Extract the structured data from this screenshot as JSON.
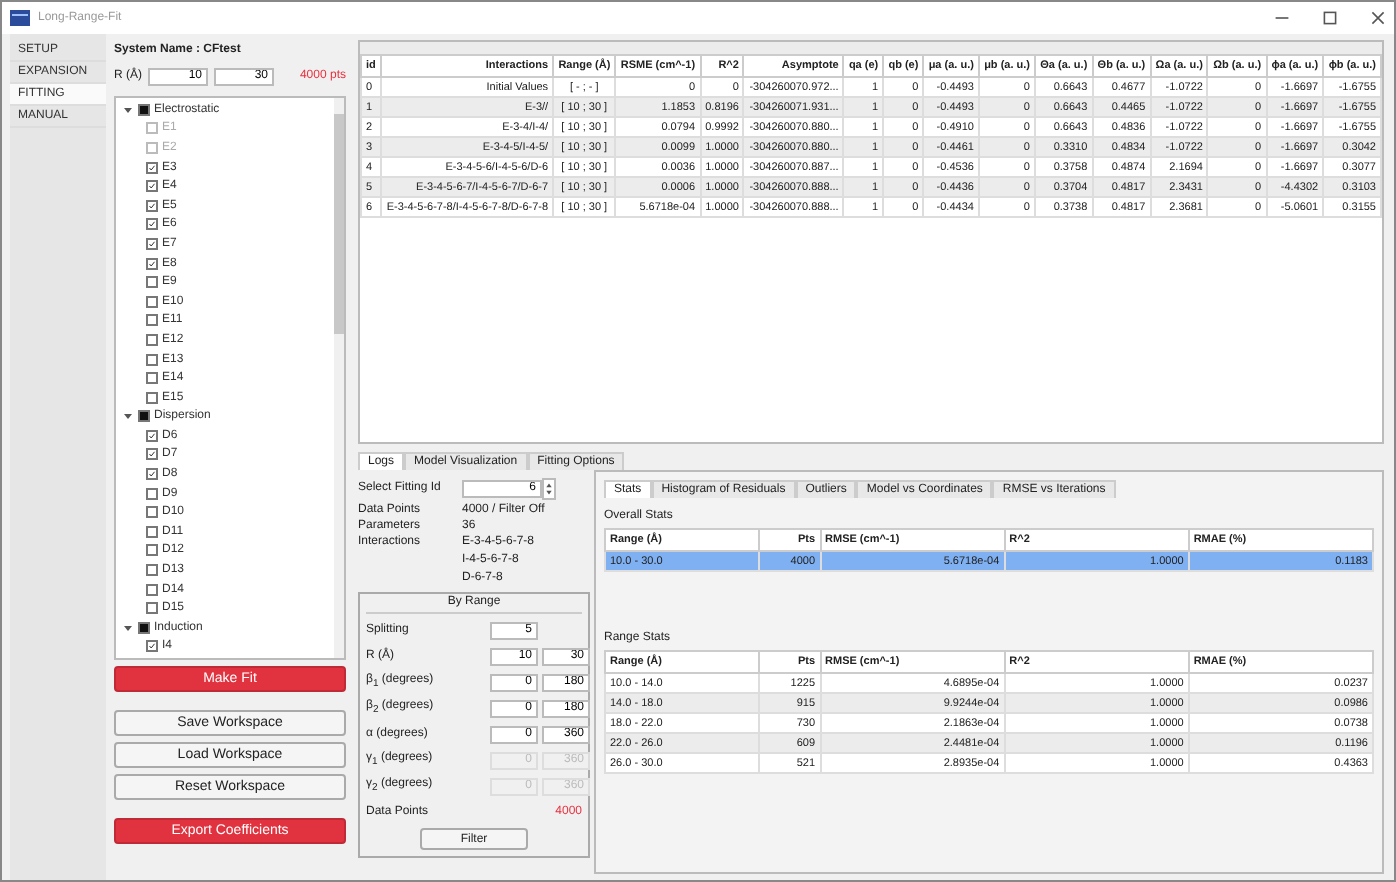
{
  "window": {
    "title": "Long-Range-Fit"
  },
  "nav": [
    {
      "label": "SETUP",
      "selected": false
    },
    {
      "label": "EXPANSION",
      "selected": false
    },
    {
      "label": "FITTING",
      "selected": true
    },
    {
      "label": "MANUAL",
      "selected": false
    }
  ],
  "system_name": "System Name : CFtest",
  "range": {
    "label": "R (Å)",
    "min": "10",
    "max": "30",
    "points": "4000 pts"
  },
  "tree": [
    {
      "label": "Electrostatic",
      "expanded": true,
      "partial": true,
      "children": [
        {
          "label": "E1",
          "checked": false,
          "disabled": true
        },
        {
          "label": "E2",
          "checked": false,
          "disabled": true
        },
        {
          "label": "E3",
          "checked": true,
          "disabled": false
        },
        {
          "label": "E4",
          "checked": true,
          "disabled": false
        },
        {
          "label": "E5",
          "checked": true,
          "disabled": false
        },
        {
          "label": "E6",
          "checked": true,
          "disabled": false
        },
        {
          "label": "E7",
          "checked": true,
          "disabled": false
        },
        {
          "label": "E8",
          "checked": true,
          "disabled": false
        },
        {
          "label": "E9",
          "checked": false,
          "disabled": false
        },
        {
          "label": "E10",
          "checked": false,
          "disabled": false
        },
        {
          "label": "E11",
          "checked": false,
          "disabled": false
        },
        {
          "label": "E12",
          "checked": false,
          "disabled": false
        },
        {
          "label": "E13",
          "checked": false,
          "disabled": false
        },
        {
          "label": "E14",
          "checked": false,
          "disabled": false
        },
        {
          "label": "E15",
          "checked": false,
          "disabled": false
        }
      ]
    },
    {
      "label": "Dispersion",
      "expanded": true,
      "partial": true,
      "children": [
        {
          "label": "D6",
          "checked": true,
          "disabled": false
        },
        {
          "label": "D7",
          "checked": true,
          "disabled": false
        },
        {
          "label": "D8",
          "checked": true,
          "disabled": false
        },
        {
          "label": "D9",
          "checked": false,
          "disabled": false
        },
        {
          "label": "D10",
          "checked": false,
          "disabled": false
        },
        {
          "label": "D11",
          "checked": false,
          "disabled": false
        },
        {
          "label": "D12",
          "checked": false,
          "disabled": false
        },
        {
          "label": "D13",
          "checked": false,
          "disabled": false
        },
        {
          "label": "D14",
          "checked": false,
          "disabled": false
        },
        {
          "label": "D15",
          "checked": false,
          "disabled": false
        }
      ]
    },
    {
      "label": "Induction",
      "expanded": true,
      "partial": true,
      "children": [
        {
          "label": "I4",
          "checked": true,
          "disabled": false
        }
      ]
    }
  ],
  "buttons": [
    {
      "label": "Make Fit",
      "kind": "primary"
    },
    {
      "label": "Save Workspace",
      "kind": "normal"
    },
    {
      "label": "Load Workspace",
      "kind": "normal"
    },
    {
      "label": "Reset Workspace",
      "kind": "normal"
    },
    {
      "label": "Export Coefficients",
      "kind": "primary"
    }
  ],
  "results": {
    "columns": [
      "id",
      "Interactions",
      "Range (Å)",
      "RSME (cm^-1)",
      "R^2",
      "Asymptote",
      "qa (e)",
      "qb (e)",
      "μa (a. u.)",
      "μb (a. u.)",
      "Θa (a. u.)",
      "Θb (a. u.)",
      "Ωa (a. u.)",
      "Ωb (a. u.)",
      "ϕa (a. u.)",
      "ϕb (a. u.)"
    ],
    "rows": [
      [
        "0",
        "Initial Values",
        "[ - ; - ]",
        "0",
        "0",
        "-304260070.972...",
        "1",
        "0",
        "-0.4493",
        "0",
        "0.6643",
        "0.4677",
        "-1.0722",
        "0",
        "-1.6697",
        "-1.6755"
      ],
      [
        "1",
        "E-3//",
        "[ 10 ; 30 ]",
        "1.1853",
        "0.8196",
        "-304260071.931...",
        "1",
        "0",
        "-0.4493",
        "0",
        "0.6643",
        "0.4465",
        "-1.0722",
        "0",
        "-1.6697",
        "-1.6755"
      ],
      [
        "2",
        "E-3-4/I-4/",
        "[ 10 ; 30 ]",
        "0.0794",
        "0.9992",
        "-304260070.880...",
        "1",
        "0",
        "-0.4910",
        "0",
        "0.6643",
        "0.4836",
        "-1.0722",
        "0",
        "-1.6697",
        "-1.6755"
      ],
      [
        "3",
        "E-3-4-5/I-4-5/",
        "[ 10 ; 30 ]",
        "0.0099",
        "1.0000",
        "-304260070.880...",
        "1",
        "0",
        "-0.4461",
        "0",
        "0.3310",
        "0.4834",
        "-1.0722",
        "0",
        "-1.6697",
        "0.3042"
      ],
      [
        "4",
        "E-3-4-5-6/I-4-5-6/D-6",
        "[ 10 ; 30 ]",
        "0.0036",
        "1.0000",
        "-304260070.887...",
        "1",
        "0",
        "-0.4536",
        "0",
        "0.3758",
        "0.4874",
        "2.1694",
        "0",
        "-1.6697",
        "0.3077"
      ],
      [
        "5",
        "E-3-4-5-6-7/I-4-5-6-7/D-6-7",
        "[ 10 ; 30 ]",
        "0.0006",
        "1.0000",
        "-304260070.888...",
        "1",
        "0",
        "-0.4436",
        "0",
        "0.3704",
        "0.4817",
        "2.3431",
        "0",
        "-4.4302",
        "0.3103"
      ],
      [
        "6",
        "E-3-4-5-6-7-8/I-4-5-6-7-8/D-6-7-8",
        "[ 10 ; 30 ]",
        "5.6718e-04",
        "1.0000",
        "-304260070.888...",
        "1",
        "0",
        "-0.4434",
        "0",
        "0.3738",
        "0.4817",
        "2.3681",
        "0",
        "-5.0601",
        "0.3155"
      ]
    ]
  },
  "bottom_tabs": [
    {
      "label": "Logs",
      "selected": true
    },
    {
      "label": "Model Visualization",
      "selected": false
    },
    {
      "label": "Fitting Options",
      "selected": false
    }
  ],
  "logs": {
    "fitting_id": {
      "label": "Select Fitting Id",
      "value": "6"
    },
    "info": [
      {
        "label": "Data Points",
        "values": [
          "4000 / Filter Off"
        ]
      },
      {
        "label": "Parameters",
        "values": [
          "36"
        ]
      },
      {
        "label": "Interactions",
        "values": [
          "E-3-4-5-6-7-8",
          "I-4-5-6-7-8",
          "D-6-7-8"
        ]
      }
    ],
    "by_range": {
      "title": "By Range",
      "fields": [
        {
          "label": "Splitting",
          "values": [
            "5"
          ],
          "disabled": false
        },
        {
          "label": "R (Å)",
          "values": [
            "10",
            "30"
          ],
          "disabled": false
        },
        {
          "label": "β$_{1}$ (degrees)",
          "values": [
            "0",
            "180"
          ],
          "disabled": false
        },
        {
          "label": "β$_{2}$ (degrees)",
          "values": [
            "0",
            "180"
          ],
          "disabled": false
        },
        {
          "label": "α (degrees)",
          "values": [
            "0",
            "360"
          ],
          "disabled": false
        },
        {
          "label": "γ$_{1}$ (degrees)",
          "values": [
            "0",
            "360"
          ],
          "disabled": true
        },
        {
          "label": "γ$_{2}$ (degrees)",
          "values": [
            "0",
            "360"
          ],
          "disabled": true
        }
      ],
      "data_points": {
        "label": "Data Points",
        "value": "4000"
      },
      "button": "Filter"
    }
  },
  "stats_tabs": [
    {
      "label": "Stats",
      "selected": true
    },
    {
      "label": "Histogram of Residuals",
      "selected": false
    },
    {
      "label": "Outliers",
      "selected": false
    },
    {
      "label": "Model vs Coordinates",
      "selected": false
    },
    {
      "label": "RMSE vs Iterations",
      "selected": false
    }
  ],
  "overall_stats": {
    "title": "Overall Stats",
    "columns": [
      "Range (Å)",
      "Pts",
      "RMSE (cm^-1)",
      "R^2",
      "RMAE (%)"
    ],
    "rows": [
      {
        "cells": [
          "10.0 - 30.0",
          "4000",
          "5.6718e-04",
          "1.0000",
          "0.1183"
        ],
        "selected": true
      }
    ]
  },
  "range_stats": {
    "title": "Range Stats",
    "columns": [
      "Range (Å)",
      "Pts",
      "RMSE (cm^-1)",
      "R^2",
      "RMAE (%)"
    ],
    "rows": [
      {
        "cells": [
          "10.0 - 14.0",
          "1225",
          "4.6895e-04",
          "1.0000",
          "0.0237"
        ],
        "selected": false
      },
      {
        "cells": [
          "14.0 - 18.0",
          "915",
          "9.9244e-04",
          "1.0000",
          "0.0986"
        ],
        "selected": false
      },
      {
        "cells": [
          "18.0 - 22.0",
          "730",
          "2.1863e-04",
          "1.0000",
          "0.0738"
        ],
        "selected": false
      },
      {
        "cells": [
          "22.0 - 26.0",
          "609",
          "2.4481e-04",
          "1.0000",
          "0.1196"
        ],
        "selected": false
      },
      {
        "cells": [
          "26.0 - 30.0",
          "521",
          "2.8935e-04",
          "1.0000",
          "0.4363"
        ],
        "selected": false
      }
    ]
  }
}
